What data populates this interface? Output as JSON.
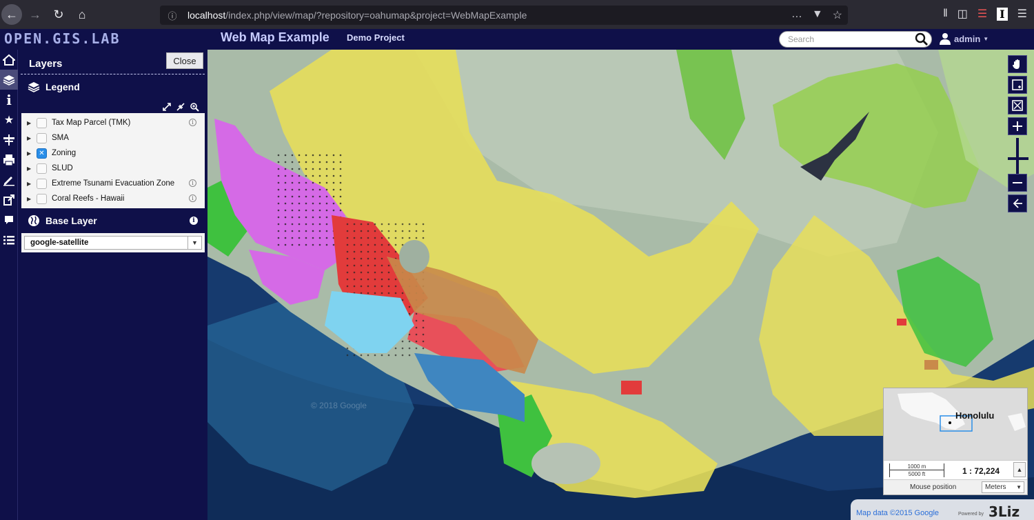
{
  "browser": {
    "url_host": "localhost",
    "url_rest": "/index.php/view/map/?repository=oahumap&project=WebMapExample"
  },
  "header": {
    "logo": "OPEN.GIS.LAB",
    "title": "Web Map Example",
    "project": "Demo Project",
    "search_placeholder": "Search",
    "user": "admin"
  },
  "rail": {
    "icons": [
      "home-icon",
      "layers-icon",
      "info-icon",
      "star-icon",
      "measure-icon",
      "print-icon",
      "edit-icon",
      "share-icon",
      "comment-icon",
      "list-icon"
    ]
  },
  "layers_panel": {
    "title": "Layers",
    "close_label": "Close",
    "legend_label": "Legend",
    "layers": [
      {
        "label": "Tax Map Parcel (TMK)",
        "checked": false,
        "info": true
      },
      {
        "label": "SMA",
        "checked": false,
        "info": false
      },
      {
        "label": "Zoning",
        "checked": true,
        "info": false
      },
      {
        "label": "SLUD",
        "checked": false,
        "info": false
      },
      {
        "label": "Extreme Tsunami Evacuation Zone",
        "checked": false,
        "info": true
      },
      {
        "label": "Coral Reefs - Hawaii",
        "checked": false,
        "info": true
      }
    ],
    "base_layer_label": "Base Layer",
    "base_layer_value": "google-satellite"
  },
  "map": {
    "overview_label": "Honolulu",
    "scale_metric": "1000 m",
    "scale_imperial": "5000 ft",
    "scale_ratio": "1 : 72,224",
    "mouse_position_label": "Mouse position",
    "units_value": "Meters",
    "attribution": "Map data ©2015 Google",
    "powered_by": "Powered by",
    "powered_brand": "3Liz",
    "watermark": "© 2018 Google"
  },
  "colors": {
    "header_bg": "#0f1049",
    "zone_residential": "#e8e25a",
    "zone_agricultural": "#3fc13f",
    "zone_industrial": "#d56ae6",
    "zone_commercial": "#e23b3b",
    "zone_apartment": "#c98a4a",
    "zone_resort": "#7fd3f0",
    "zone_preservation": "#b4d890"
  }
}
